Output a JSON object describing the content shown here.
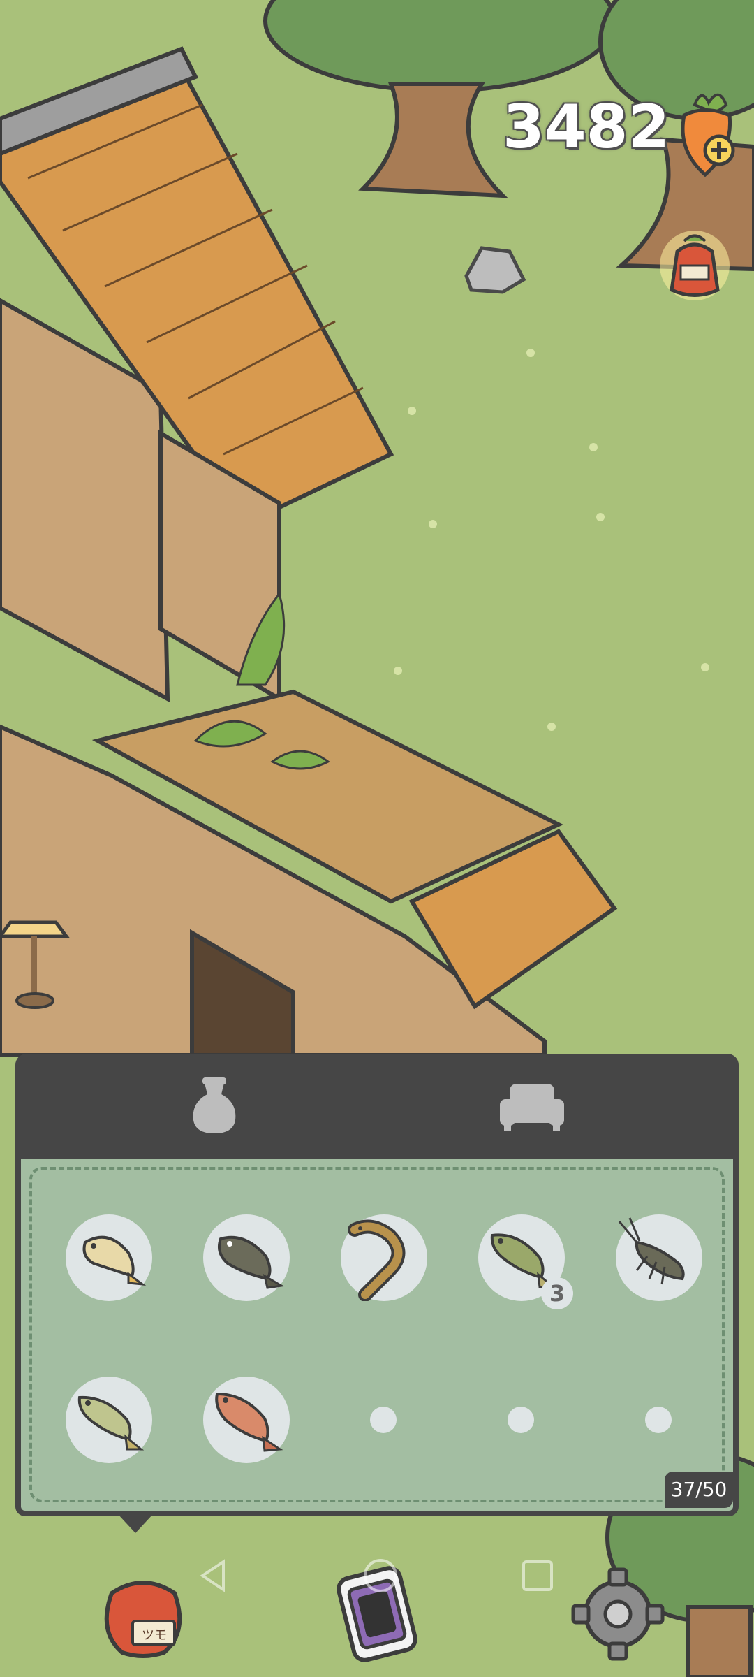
{
  "hud": {
    "currency_count": "3482",
    "currency_icon": "carrot-plus-icon",
    "pickup_icon": "seed-bag-icon"
  },
  "inventory": {
    "tabs": [
      {
        "id": "items",
        "icon": "pouch-icon",
        "active": true
      },
      {
        "id": "furniture",
        "icon": "armchair-icon",
        "active": false
      }
    ],
    "slots": [
      {
        "item": "fish-1",
        "qty": ""
      },
      {
        "item": "fish-2",
        "qty": ""
      },
      {
        "item": "eel",
        "qty": ""
      },
      {
        "item": "fish-3",
        "qty": "3"
      },
      {
        "item": "crayfish",
        "qty": ""
      },
      {
        "item": "fish-4",
        "qty": ""
      },
      {
        "item": "fish-5",
        "qty": ""
      },
      {
        "item": "",
        "qty": ""
      },
      {
        "item": "",
        "qty": ""
      },
      {
        "item": "",
        "qty": ""
      }
    ],
    "capacity": "37/50"
  },
  "toolbar": {
    "bag_label": "ツモ",
    "buttons": [
      "bag-button",
      "phone-button",
      "settings-button"
    ]
  },
  "colors": {
    "grass": "#a9c17a",
    "panel_dark": "#464646",
    "panel_body": "#a3bea2",
    "slot": "#dfe5e6"
  }
}
